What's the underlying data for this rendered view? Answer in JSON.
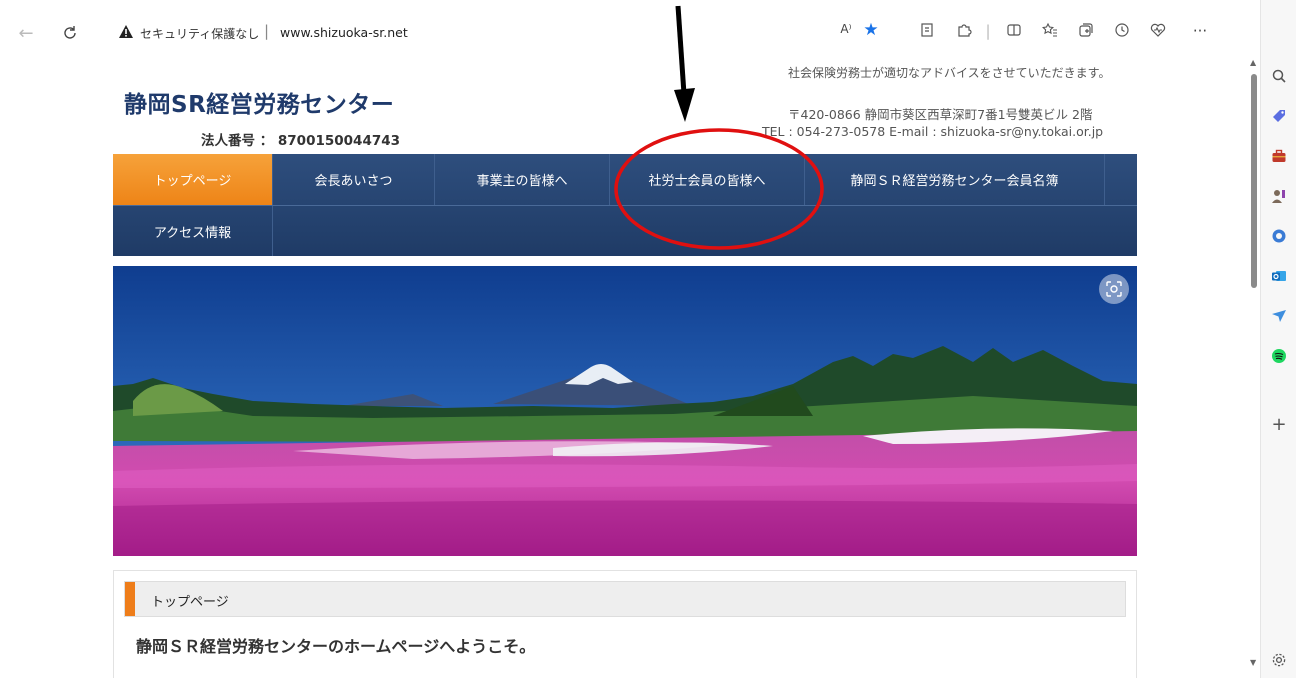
{
  "browser": {
    "security_label": "セキュリティ保護なし",
    "separator": "|",
    "url": "www.shizuoka-sr.net",
    "read_aloud": "A⁾",
    "more": "···"
  },
  "header": {
    "tagline": "社会保険労務士が適切なアドバイスをさせていただきます。",
    "title": "静岡SR経営労務センター",
    "corp_number": "法人番号 ： 8700150044743",
    "address": "〒420-0866 静岡市葵区西草深町7番1号雙英ビル 2階",
    "contact": "TEL : 054-273-0578 E-mail : shizuoka-sr@ny.tokai.or.jp"
  },
  "nav": {
    "items": [
      {
        "label": "トップページ"
      },
      {
        "label": "会長あいさつ"
      },
      {
        "label": "事業主の皆様へ"
      },
      {
        "label": "社労士会員の皆様へ"
      },
      {
        "label": "静岡ＳＲ経営労務センター会員名簿"
      },
      {
        "label": "アクセス情報"
      }
    ]
  },
  "section": {
    "title": "トップページ",
    "welcome": "静岡ＳＲ経営労務センターのホームページへようこそ。"
  },
  "colors": {
    "nav_bg": "#24426f",
    "nav_active": "#f39325",
    "title_color": "#1f3a6b",
    "annotation_red": "#e01010"
  },
  "sidebar_icons": [
    "search-icon",
    "tag-icon",
    "briefcase-icon",
    "games-icon",
    "copilot-icon",
    "outlook-icon",
    "send-icon",
    "spotify-icon",
    "add-icon",
    "settings-icon"
  ]
}
